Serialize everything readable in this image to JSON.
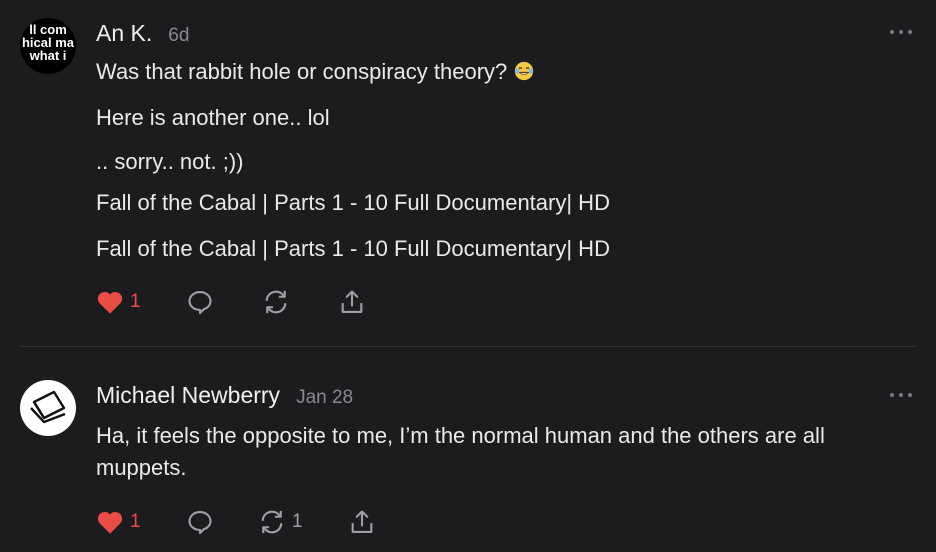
{
  "comments": [
    {
      "avatar_text": [
        "ll com",
        "hical ma",
        "what i"
      ],
      "author": "An K.",
      "time": "6d",
      "lines": [
        "Was that rabbit hole or conspiracy theory?",
        "Here is another one.. lol",
        ".. sorry.. not. ;))",
        "Fall of the Cabal | Parts 1 - 10 Full Documentary| HD",
        "Fall of the Cabal | Parts 1 - 10 Full Documentary| HD"
      ],
      "emoji": "laughing-tears-emoji",
      "likes": "1",
      "restacks": ""
    },
    {
      "author": "Michael Newberry",
      "time": "Jan 28",
      "body": "Ha, it feels the opposite to me, I’m the normal human and the others are all muppets.",
      "likes": "1",
      "restacks": "1"
    }
  ],
  "colors": {
    "background": "#1c1c1e",
    "heart": "#ea4c46",
    "muted": "#8a8a8e"
  },
  "icons": [
    "heart-icon",
    "reply-icon",
    "restack-icon",
    "share-icon",
    "more-icon"
  ]
}
